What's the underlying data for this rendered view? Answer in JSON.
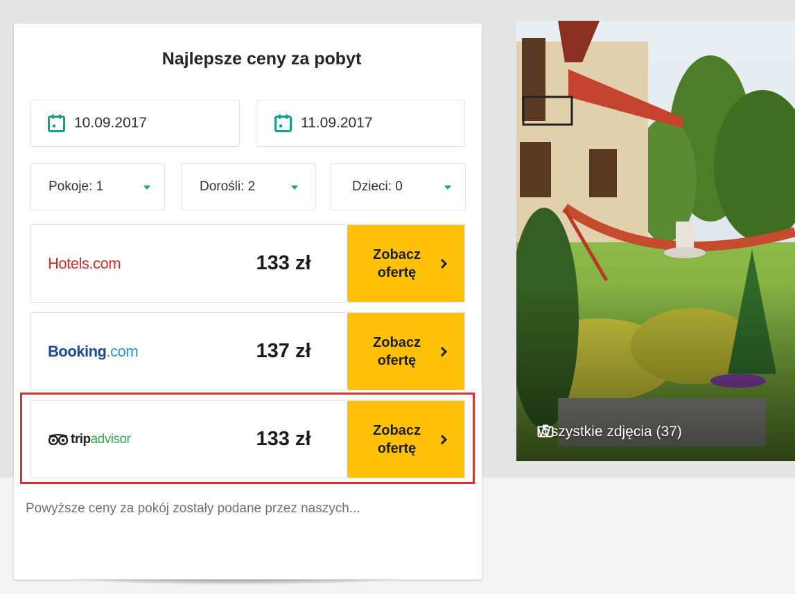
{
  "widget": {
    "title": "Najlepsze ceny za pobyt",
    "checkin_date": "10.09.2017",
    "checkout_date": "11.09.2017",
    "rooms_label": "Pokoje: 1",
    "adults_label": "Dorośli: 2",
    "children_label": "Dzieci: 0",
    "offers": [
      {
        "provider": "Hotels.com",
        "price": "133 zł",
        "button_label": "Zobacz ofertę",
        "highlighted": false
      },
      {
        "provider": "Booking.com",
        "price": "137 zł",
        "button_label": "Zobacz ofertę",
        "highlighted": false
      },
      {
        "provider": "tripadvisor",
        "price": "133 zł",
        "button_label": "Zobacz ofertę",
        "highlighted": true
      }
    ],
    "disclaimer": "Powyższe ceny za pokój zostały podane przez naszych..."
  },
  "logos": {
    "hotels": {
      "part1": "Hotels",
      "part2": ".com"
    },
    "booking": {
      "part1": "Booking",
      "part2": ".com"
    },
    "tripadvisor": {
      "part1": "trip",
      "part2": "advisor"
    }
  },
  "gallery": {
    "caption": "Wszystkie zdjęcia (37)"
  },
  "colors": {
    "accent_green": "#14a37f",
    "button_yellow": "#ffc107",
    "highlight_red": "#d8312f",
    "hotels_red": "#d32f2f",
    "booking_blue": "#1a4c99",
    "booking_light_blue": "#2e8fd8",
    "tripadvisor_green": "#34a853"
  },
  "icons": {
    "calendar": "calendar-icon",
    "dropdown": "caret-down-icon",
    "chevron": "chevron-right-icon",
    "camera": "camera-icon"
  }
}
